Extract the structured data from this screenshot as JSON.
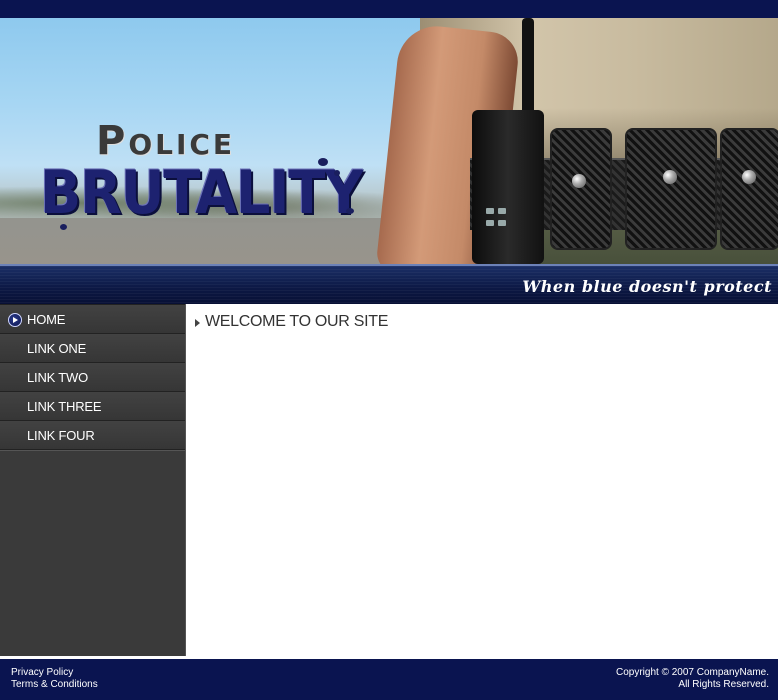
{
  "header": {
    "logo_top": "Police",
    "logo_bottom": "BRUTALITY",
    "tagline": "When blue doesn't protect"
  },
  "nav": {
    "items": [
      {
        "label": "HOME",
        "active": true
      },
      {
        "label": "LINK ONE",
        "active": false
      },
      {
        "label": "LINK TWO",
        "active": false
      },
      {
        "label": "LINK THREE",
        "active": false
      },
      {
        "label": "LINK FOUR",
        "active": false
      }
    ]
  },
  "main": {
    "title": "WELCOME TO OUR SITE"
  },
  "footer": {
    "privacy": "Privacy Policy",
    "terms": "Terms & Conditions",
    "copyright_line1": "Copyright © 2007 CompanyName.",
    "copyright_line2": "All Rights Reserved."
  },
  "colors": {
    "brand_navy": "#0a1450",
    "sidebar_bg": "#3a3a3a",
    "logo_blue": "#1d2270"
  }
}
